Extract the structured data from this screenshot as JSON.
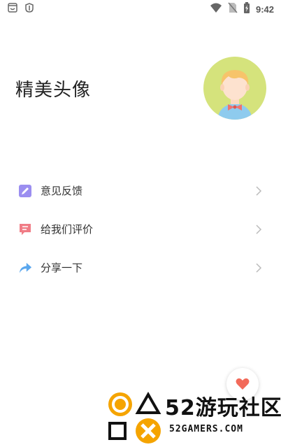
{
  "status_bar": {
    "time": "9:42",
    "left_icons": [
      "notification-icon",
      "bug-icon"
    ],
    "right_icons": [
      "wifi-icon",
      "no-sim-icon",
      "battery-charging-icon"
    ]
  },
  "header": {
    "title": "精美头像",
    "avatar_icon": "avatar-icon"
  },
  "menu": {
    "items": [
      {
        "label": "意见反馈",
        "icon": "edit-icon",
        "icon_color": "#9b8ef0"
      },
      {
        "label": "给我们评价",
        "icon": "comment-icon",
        "icon_color": "#f07c86"
      },
      {
        "label": "分享一下",
        "icon": "share-icon",
        "icon_color": "#5aa7ee"
      }
    ]
  },
  "fab": {
    "icon": "heart-icon",
    "color": "#f26a5a"
  },
  "watermark": {
    "top_text": "52游玩社区",
    "bottom_text": "52GAMERS.COM",
    "accent_color": "#f5a400"
  },
  "colors": {
    "avatar_bg": "#d5e37c",
    "text": "#222222",
    "chevron": "#bbbbbb"
  }
}
